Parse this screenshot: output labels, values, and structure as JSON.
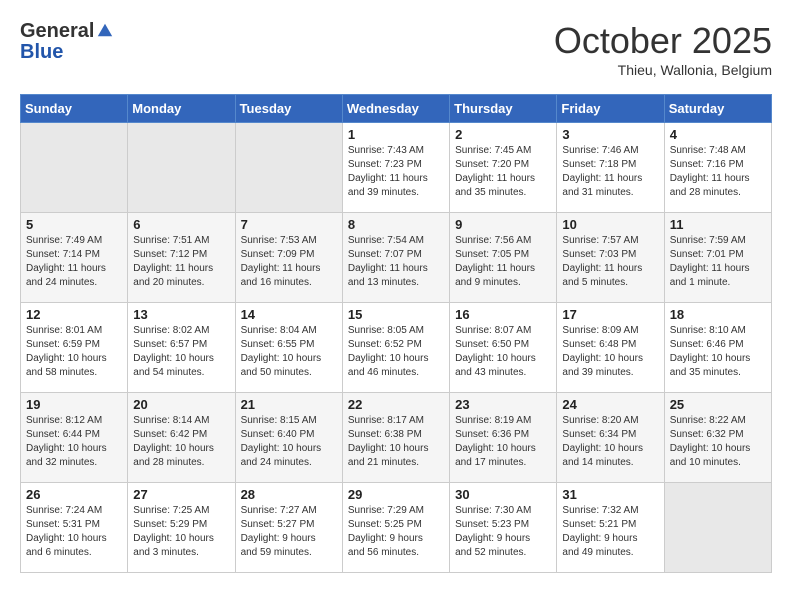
{
  "header": {
    "logo_line1": "General",
    "logo_line2": "Blue",
    "month": "October 2025",
    "location": "Thieu, Wallonia, Belgium"
  },
  "weekdays": [
    "Sunday",
    "Monday",
    "Tuesday",
    "Wednesday",
    "Thursday",
    "Friday",
    "Saturday"
  ],
  "weeks": [
    [
      {
        "day": "",
        "info": ""
      },
      {
        "day": "",
        "info": ""
      },
      {
        "day": "",
        "info": ""
      },
      {
        "day": "1",
        "info": "Sunrise: 7:43 AM\nSunset: 7:23 PM\nDaylight: 11 hours\nand 39 minutes."
      },
      {
        "day": "2",
        "info": "Sunrise: 7:45 AM\nSunset: 7:20 PM\nDaylight: 11 hours\nand 35 minutes."
      },
      {
        "day": "3",
        "info": "Sunrise: 7:46 AM\nSunset: 7:18 PM\nDaylight: 11 hours\nand 31 minutes."
      },
      {
        "day": "4",
        "info": "Sunrise: 7:48 AM\nSunset: 7:16 PM\nDaylight: 11 hours\nand 28 minutes."
      }
    ],
    [
      {
        "day": "5",
        "info": "Sunrise: 7:49 AM\nSunset: 7:14 PM\nDaylight: 11 hours\nand 24 minutes."
      },
      {
        "day": "6",
        "info": "Sunrise: 7:51 AM\nSunset: 7:12 PM\nDaylight: 11 hours\nand 20 minutes."
      },
      {
        "day": "7",
        "info": "Sunrise: 7:53 AM\nSunset: 7:09 PM\nDaylight: 11 hours\nand 16 minutes."
      },
      {
        "day": "8",
        "info": "Sunrise: 7:54 AM\nSunset: 7:07 PM\nDaylight: 11 hours\nand 13 minutes."
      },
      {
        "day": "9",
        "info": "Sunrise: 7:56 AM\nSunset: 7:05 PM\nDaylight: 11 hours\nand 9 minutes."
      },
      {
        "day": "10",
        "info": "Sunrise: 7:57 AM\nSunset: 7:03 PM\nDaylight: 11 hours\nand 5 minutes."
      },
      {
        "day": "11",
        "info": "Sunrise: 7:59 AM\nSunset: 7:01 PM\nDaylight: 11 hours\nand 1 minute."
      }
    ],
    [
      {
        "day": "12",
        "info": "Sunrise: 8:01 AM\nSunset: 6:59 PM\nDaylight: 10 hours\nand 58 minutes."
      },
      {
        "day": "13",
        "info": "Sunrise: 8:02 AM\nSunset: 6:57 PM\nDaylight: 10 hours\nand 54 minutes."
      },
      {
        "day": "14",
        "info": "Sunrise: 8:04 AM\nSunset: 6:55 PM\nDaylight: 10 hours\nand 50 minutes."
      },
      {
        "day": "15",
        "info": "Sunrise: 8:05 AM\nSunset: 6:52 PM\nDaylight: 10 hours\nand 46 minutes."
      },
      {
        "day": "16",
        "info": "Sunrise: 8:07 AM\nSunset: 6:50 PM\nDaylight: 10 hours\nand 43 minutes."
      },
      {
        "day": "17",
        "info": "Sunrise: 8:09 AM\nSunset: 6:48 PM\nDaylight: 10 hours\nand 39 minutes."
      },
      {
        "day": "18",
        "info": "Sunrise: 8:10 AM\nSunset: 6:46 PM\nDaylight: 10 hours\nand 35 minutes."
      }
    ],
    [
      {
        "day": "19",
        "info": "Sunrise: 8:12 AM\nSunset: 6:44 PM\nDaylight: 10 hours\nand 32 minutes."
      },
      {
        "day": "20",
        "info": "Sunrise: 8:14 AM\nSunset: 6:42 PM\nDaylight: 10 hours\nand 28 minutes."
      },
      {
        "day": "21",
        "info": "Sunrise: 8:15 AM\nSunset: 6:40 PM\nDaylight: 10 hours\nand 24 minutes."
      },
      {
        "day": "22",
        "info": "Sunrise: 8:17 AM\nSunset: 6:38 PM\nDaylight: 10 hours\nand 21 minutes."
      },
      {
        "day": "23",
        "info": "Sunrise: 8:19 AM\nSunset: 6:36 PM\nDaylight: 10 hours\nand 17 minutes."
      },
      {
        "day": "24",
        "info": "Sunrise: 8:20 AM\nSunset: 6:34 PM\nDaylight: 10 hours\nand 14 minutes."
      },
      {
        "day": "25",
        "info": "Sunrise: 8:22 AM\nSunset: 6:32 PM\nDaylight: 10 hours\nand 10 minutes."
      }
    ],
    [
      {
        "day": "26",
        "info": "Sunrise: 7:24 AM\nSunset: 5:31 PM\nDaylight: 10 hours\nand 6 minutes."
      },
      {
        "day": "27",
        "info": "Sunrise: 7:25 AM\nSunset: 5:29 PM\nDaylight: 10 hours\nand 3 minutes."
      },
      {
        "day": "28",
        "info": "Sunrise: 7:27 AM\nSunset: 5:27 PM\nDaylight: 9 hours\nand 59 minutes."
      },
      {
        "day": "29",
        "info": "Sunrise: 7:29 AM\nSunset: 5:25 PM\nDaylight: 9 hours\nand 56 minutes."
      },
      {
        "day": "30",
        "info": "Sunrise: 7:30 AM\nSunset: 5:23 PM\nDaylight: 9 hours\nand 52 minutes."
      },
      {
        "day": "31",
        "info": "Sunrise: 7:32 AM\nSunset: 5:21 PM\nDaylight: 9 hours\nand 49 minutes."
      },
      {
        "day": "",
        "info": ""
      }
    ]
  ]
}
